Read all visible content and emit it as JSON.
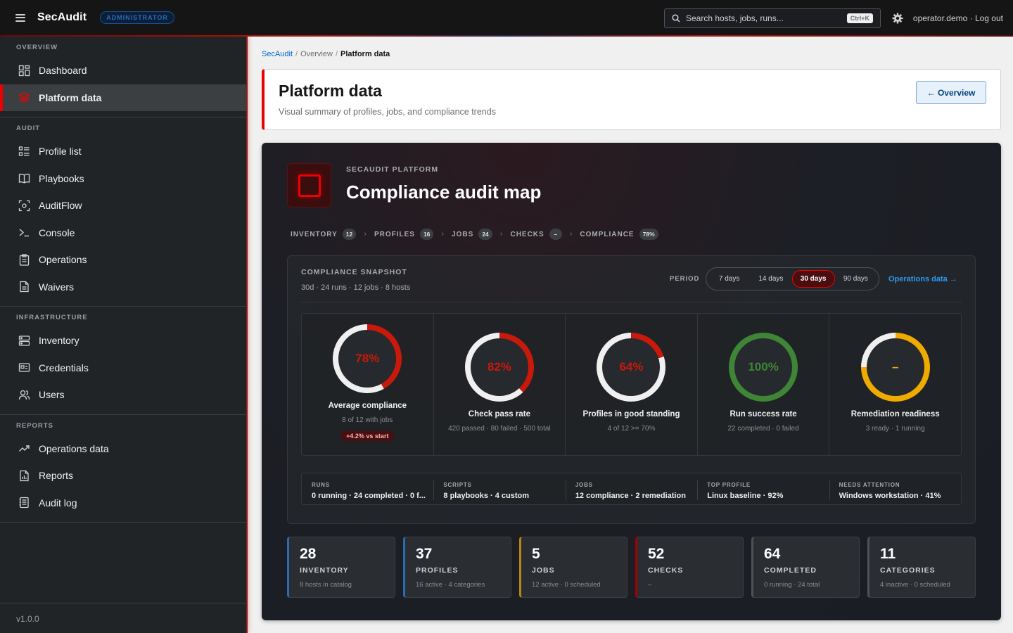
{
  "app": {
    "brand": "SecAudit",
    "role_badge": "ADMINISTRATOR"
  },
  "topbar": {
    "search_placeholder": "Search hosts, jobs, runs...",
    "shortcut": "Ctrl+K",
    "user": "operator.demo · Log out"
  },
  "sidebar": {
    "sections": [
      {
        "title": "OVERVIEW",
        "items": [
          {
            "label": "Dashboard",
            "icon": "dashboard-icon",
            "active": false
          },
          {
            "label": "Platform data",
            "icon": "layers-icon",
            "active": true
          }
        ]
      },
      {
        "title": "AUDIT",
        "items": [
          {
            "label": "Profile list",
            "icon": "list-icon",
            "active": false
          },
          {
            "label": "Playbooks",
            "icon": "book-icon",
            "active": false
          },
          {
            "label": "AuditFlow",
            "icon": "scan-icon",
            "active": false
          },
          {
            "label": "Console",
            "icon": "terminal-icon",
            "active": false
          },
          {
            "label": "Operations",
            "icon": "clipboard-icon",
            "active": false
          },
          {
            "label": "Waivers",
            "icon": "document-icon",
            "active": false
          }
        ]
      },
      {
        "title": "INFRASTRUCTURE",
        "items": [
          {
            "label": "Inventory",
            "icon": "server-icon",
            "active": false
          },
          {
            "label": "Credentials",
            "icon": "credential-card-icon",
            "active": false
          },
          {
            "label": "Users",
            "icon": "users-icon",
            "active": false
          }
        ]
      },
      {
        "title": "REPORTS",
        "items": [
          {
            "label": "Operations data",
            "icon": "trend-icon",
            "active": false
          },
          {
            "label": "Reports",
            "icon": "report-icon",
            "active": false
          },
          {
            "label": "Audit log",
            "icon": "log-icon",
            "active": false
          }
        ]
      }
    ],
    "version": "v1.0.0"
  },
  "breadcrumb": {
    "root": "SecAudit",
    "parent": "Overview",
    "current": "Platform data"
  },
  "header": {
    "title": "Platform data",
    "subtitle": "Visual summary of profiles, jobs, and compliance trends",
    "back_label": "← Overview"
  },
  "dashboard": {
    "eyebrow": "SECAUDIT PLATFORM",
    "title": "Compliance audit map",
    "pipeline": [
      {
        "label": "INVENTORY",
        "count": "12"
      },
      {
        "label": "PROFILES",
        "count": "16"
      },
      {
        "label": "JOBS",
        "count": "24"
      },
      {
        "label": "CHECKS",
        "count": "–"
      },
      {
        "label": "COMPLIANCE",
        "count": "78%"
      }
    ],
    "snapshot": {
      "title": "COMPLIANCE SNAPSHOT",
      "subtitle": "30d · 24 runs · 12 jobs · 8 hosts",
      "period_label": "PERIOD",
      "periods": [
        "7 days",
        "14 days",
        "30 days",
        "90 days"
      ],
      "active_period": "30 days",
      "ops_link": "Operations data →"
    },
    "gauges": [
      {
        "value_text": "78%",
        "fraction": 0.42,
        "color": "#c9190b",
        "text_color": "#c9190b",
        "label": "Average compliance",
        "sub": "8 of 12 with jobs",
        "delta": "+4.2% vs start",
        "offset": "top"
      },
      {
        "value_text": "82%",
        "fraction": 0.38,
        "color": "#c9190b",
        "text_color": "#c9190b",
        "label": "Check pass rate",
        "sub": "420 passed · 80 failed · 500 total",
        "delta": "",
        "offset": "mid"
      },
      {
        "value_text": "64%",
        "fraction": 0.2,
        "color": "#c9190b",
        "text_color": "#c9190b",
        "label": "Profiles in good standing",
        "sub": "4 of 12 >= 70%",
        "delta": "",
        "offset": "mid"
      },
      {
        "value_text": "100%",
        "fraction": 1.0,
        "color": "#3e8635",
        "text_color": "#3e8635",
        "label": "Run success rate",
        "sub": "22 completed · 0 failed",
        "delta": "",
        "offset": "mid"
      },
      {
        "value_text": "–",
        "fraction": 0.75,
        "color": "#f0ab00",
        "text_color": "#f0ab00",
        "label": "Remediation readiness",
        "sub": "3 ready · 1 running",
        "delta": "",
        "offset": "mid"
      }
    ],
    "summary": [
      {
        "label": "RUNS",
        "value": "0 running · 24 completed · 0 f..."
      },
      {
        "label": "SCRIPTS",
        "value": "8 playbooks · 4 custom"
      },
      {
        "label": "JOBS",
        "value": "12 compliance · 2 remediation"
      },
      {
        "label": "TOP PROFILE",
        "value": "Linux baseline · 92%"
      },
      {
        "label": "NEEDS ATTENTION",
        "value": "Windows workstation · 41%"
      }
    ],
    "stats": [
      {
        "num": "28",
        "label": "INVENTORY",
        "sub": "8 hosts in catalog",
        "color": "#2b6cb0"
      },
      {
        "num": "37",
        "label": "PROFILES",
        "sub": "16 active · 4 categories",
        "color": "#2b6cb0"
      },
      {
        "num": "5",
        "label": "JOBS",
        "sub": "12 active · 0 scheduled",
        "color": "#b8860b"
      },
      {
        "num": "52",
        "label": "CHECKS",
        "sub": "–",
        "color": "#a30000"
      },
      {
        "num": "64",
        "label": "COMPLETED",
        "sub": "0 running · 24 total",
        "color": "#4f5255"
      },
      {
        "num": "11",
        "label": "CATEGORIES",
        "sub": "4 inactive · 0 scheduled",
        "color": "#4f5255"
      }
    ]
  }
}
